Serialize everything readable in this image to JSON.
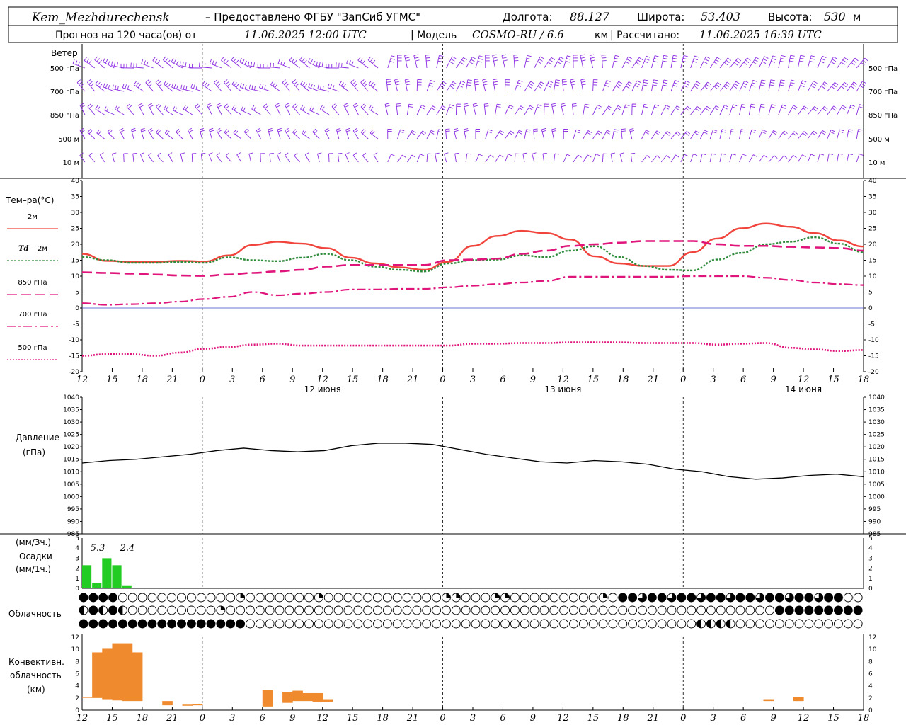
{
  "header": {
    "station": "Kem_Mezhdurechensk",
    "provider": "– Предоставлено ФГБУ \"ЗапСиб УГМС\"",
    "lon_label": "Долгота:",
    "lon_value": "88.127",
    "lat_label": "Широта:",
    "lat_value": "53.403",
    "alt_label": "Высота:",
    "alt_value": "530",
    "alt_unit": "м",
    "forecast_label": "Прогноз на 120 часа(ов)  от",
    "forecast_start": "11.06.2025 12:00 UTC",
    "model_label": "| Модель",
    "model_name": "COSMO-RU / 6.6",
    "model_unit": "км",
    "calc_label": "| Рассчитано:",
    "calc_time": "11.06.2025 16:39 UTC"
  },
  "panels": {
    "wind": {
      "title": "Ветер",
      "levels": [
        "500 гПа",
        "700 гПа",
        "850 гПа",
        "500 м",
        "10 м"
      ]
    },
    "temperature": {
      "title": "Тем–ра(°C)",
      "legend": [
        {
          "label": "2м",
          "color": "#f0443c"
        },
        {
          "label": "Td",
          "sub": "2м",
          "color": "#2e8b3a"
        },
        {
          "label": "850 гПа",
          "color": "#e0157c"
        },
        {
          "label": "700 гПа",
          "color": "#e0157c"
        },
        {
          "label": "500 гПа",
          "color": "#e0157c"
        }
      ]
    },
    "pressure": {
      "title": "Давление",
      "unit": "(гПа)"
    },
    "precip": {
      "unit_top": "(мм/3ч.)",
      "title": "Осадки",
      "unit_bottom": "(мм/1ч.)",
      "labels": [
        "5.3",
        "2.4"
      ]
    },
    "cloud": {
      "title": "Облачность"
    },
    "convective": {
      "title_l1": "Конвективн.",
      "title_l2": "облачность",
      "unit": "(км)"
    }
  },
  "time_axis": {
    "tick_labels": [
      "12",
      "15",
      "18",
      "21",
      "0",
      "3",
      "6",
      "9",
      "12",
      "15",
      "18",
      "21",
      "0",
      "3",
      "6",
      "9",
      "12",
      "15",
      "18",
      "21",
      "0",
      "3",
      "6",
      "9",
      "12",
      "15",
      "18"
    ],
    "day_labels": [
      "12 июня",
      "13 июня",
      "14 июня"
    ]
  },
  "chart_data": [
    {
      "type": "line",
      "title": "Тем–ра(°C)",
      "ylim": [
        -20,
        40
      ],
      "yticks": [
        40,
        35,
        30,
        25,
        20,
        15,
        10,
        5,
        0,
        -5,
        -10,
        -15,
        -20
      ],
      "x_hours": [
        0,
        3,
        6,
        9,
        12,
        15,
        18,
        21,
        24,
        27,
        30,
        33,
        36,
        39,
        42,
        45,
        48,
        51,
        54,
        57,
        60,
        63,
        66,
        69,
        72,
        75,
        78
      ],
      "series": [
        {
          "name": "2м",
          "color": "#f0443c",
          "values": [
            17,
            14.8,
            14.5,
            14.5,
            14.8,
            14.6,
            16.5,
            19.8,
            20.8,
            20.2,
            18.8,
            15.8,
            14,
            12.8,
            12,
            14.5,
            19.5,
            22.6,
            24.2,
            23.5,
            21.5,
            16.2,
            14,
            13.2,
            13.2,
            17.5,
            21.8,
            25,
            26.5,
            25.5,
            23.5,
            21.2,
            19.3
          ]
        },
        {
          "name": "Td 2м",
          "color": "#2e8b3a",
          "values": [
            16,
            15,
            14.2,
            14.2,
            14.5,
            14.2,
            15.9,
            15.0,
            14.7,
            15.8,
            17.0,
            15.0,
            13.0,
            12.0,
            11.5,
            14.0,
            15.0,
            15.2,
            16.5,
            16.0,
            18.0,
            19.4,
            16,
            13.2,
            12.0,
            11.8,
            15.2,
            17.3,
            20.0,
            20.8,
            22.2,
            20.2,
            17.5
          ]
        },
        {
          "name": "850 гПа",
          "color": "#e0157c",
          "values": [
            11.2,
            11,
            10.8,
            10.5,
            10.2,
            10.1,
            10.5,
            11,
            11.5,
            12,
            13,
            13.5,
            13.5,
            13.5,
            13.5,
            15,
            15.2,
            15.5,
            17,
            18,
            19.5,
            20,
            20.5,
            21,
            21,
            21,
            20,
            19.5,
            19.5,
            19.2,
            19,
            18.8,
            18
          ]
        },
        {
          "name": "700 гПа",
          "color": "#e0157c",
          "values": [
            1.5,
            1,
            1.2,
            1.5,
            2,
            2.8,
            3.5,
            5,
            4,
            4.5,
            5,
            5.8,
            5.8,
            6,
            6,
            6.5,
            7,
            7.5,
            8,
            8.5,
            9.8,
            9.8,
            9.8,
            9.8,
            9.8,
            10,
            10,
            10,
            9.5,
            8.8,
            8,
            7.5,
            7.2
          ]
        },
        {
          "name": "500 гПа",
          "color": "#e0157c",
          "values": [
            -15,
            -14.5,
            -14.5,
            -15,
            -14,
            -12.8,
            -12.2,
            -11.5,
            -11.2,
            -11.8,
            -11.8,
            -11.8,
            -11.8,
            -11.8,
            -11.8,
            -11.8,
            -11.2,
            -11.2,
            -11,
            -11,
            -10.8,
            -10.8,
            -10.8,
            -11,
            -11,
            -11,
            -11.5,
            -11.2,
            -11,
            -12.5,
            -13,
            -13.5,
            -13.2
          ]
        }
      ]
    },
    {
      "type": "line",
      "title": "Давление (гПа)",
      "ylim": [
        985,
        1040
      ],
      "yticks": [
        1040,
        1035,
        1030,
        1025,
        1020,
        1015,
        1010,
        1005,
        1000,
        995,
        990,
        985
      ],
      "series": [
        {
          "name": "Давление",
          "color": "#000000",
          "values": [
            1013.5,
            1014.5,
            1015,
            1016,
            1017,
            1018.5,
            1019.5,
            1018.5,
            1018,
            1018.5,
            1020.5,
            1021.5,
            1021.5,
            1021,
            1019,
            1017,
            1015.5,
            1014,
            1013.5,
            1014.5,
            1014,
            1013,
            1011,
            1010,
            1008,
            1007,
            1007.5,
            1008.5,
            1009,
            1008
          ]
        }
      ]
    },
    {
      "type": "bar",
      "title": "Осадки (мм/1ч.)",
      "ylim": [
        0,
        5
      ],
      "x_hours": [
        0,
        1,
        2,
        3,
        4,
        5
      ],
      "values": [
        2.3,
        0.5,
        3.0,
        2.3,
        0.3,
        0
      ],
      "color": "#22cc22",
      "annotations": [
        "5.3",
        "2.4"
      ]
    },
    {
      "type": "bar",
      "title": "Конвективн. облачность (км)",
      "ylim": [
        0,
        12
      ],
      "bars": [
        {
          "x": 0,
          "bottom": 2.2,
          "top": 2.2
        },
        {
          "x": 1,
          "bottom": 2.0,
          "top": 9.5
        },
        {
          "x": 2,
          "bottom": 1.8,
          "top": 10.2
        },
        {
          "x": 3,
          "bottom": 1.6,
          "top": 11.0
        },
        {
          "x": 4,
          "bottom": 1.5,
          "top": 11.0
        },
        {
          "x": 5,
          "bottom": 1.5,
          "top": 9.5
        },
        {
          "x": 8,
          "bottom": 0.8,
          "top": 1.5
        },
        {
          "x": 10,
          "bottom": 0.8,
          "top": 0.9
        },
        {
          "x": 11,
          "bottom": 0.8,
          "top": 1.0
        },
        {
          "x": 18,
          "bottom": 0.6,
          "top": 3.3
        },
        {
          "x": 20,
          "bottom": 1.2,
          "top": 3.0
        },
        {
          "x": 21,
          "bottom": 1.5,
          "top": 3.2
        },
        {
          "x": 22,
          "bottom": 1.5,
          "top": 2.8
        },
        {
          "x": 23,
          "bottom": 1.4,
          "top": 2.8
        },
        {
          "x": 24,
          "bottom": 1.4,
          "top": 1.8
        },
        {
          "x": 68,
          "bottom": 1.5,
          "top": 1.8
        },
        {
          "x": 71,
          "bottom": 1.5,
          "top": 2.2
        }
      ],
      "color": "#f08a2e"
    }
  ]
}
